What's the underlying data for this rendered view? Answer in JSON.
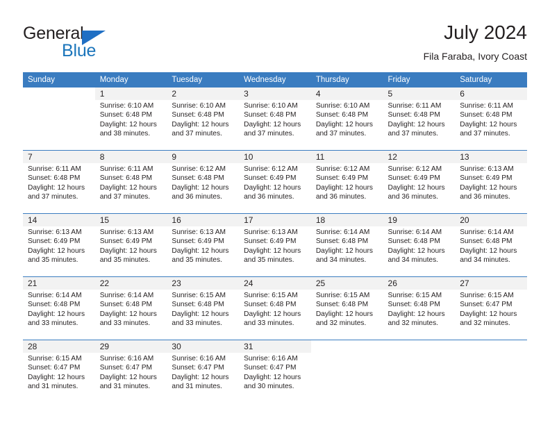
{
  "logo": {
    "word1": "General",
    "word2": "Blue",
    "triangle_color": "#1f6fc4",
    "blue_color": "#1b75bb"
  },
  "header": {
    "title": "July 2024",
    "subtitle": "Fila Faraba, Ivory Coast"
  },
  "theme": {
    "header_blue": "#3a7cc0",
    "band_gray": "#f2f2f2"
  },
  "weekday_headers": [
    "Sunday",
    "Monday",
    "Tuesday",
    "Wednesday",
    "Thursday",
    "Friday",
    "Saturday"
  ],
  "weeks": [
    [
      {
        "day": "",
        "lines": [
          "",
          "",
          "",
          ""
        ],
        "blank": true
      },
      {
        "day": "1",
        "lines": [
          "Sunrise: 6:10 AM",
          "Sunset: 6:48 PM",
          "Daylight: 12 hours",
          "and 38 minutes."
        ]
      },
      {
        "day": "2",
        "lines": [
          "Sunrise: 6:10 AM",
          "Sunset: 6:48 PM",
          "Daylight: 12 hours",
          "and 37 minutes."
        ]
      },
      {
        "day": "3",
        "lines": [
          "Sunrise: 6:10 AM",
          "Sunset: 6:48 PM",
          "Daylight: 12 hours",
          "and 37 minutes."
        ]
      },
      {
        "day": "4",
        "lines": [
          "Sunrise: 6:10 AM",
          "Sunset: 6:48 PM",
          "Daylight: 12 hours",
          "and 37 minutes."
        ]
      },
      {
        "day": "5",
        "lines": [
          "Sunrise: 6:11 AM",
          "Sunset: 6:48 PM",
          "Daylight: 12 hours",
          "and 37 minutes."
        ]
      },
      {
        "day": "6",
        "lines": [
          "Sunrise: 6:11 AM",
          "Sunset: 6:48 PM",
          "Daylight: 12 hours",
          "and 37 minutes."
        ]
      }
    ],
    [
      {
        "day": "7",
        "lines": [
          "Sunrise: 6:11 AM",
          "Sunset: 6:48 PM",
          "Daylight: 12 hours",
          "and 37 minutes."
        ]
      },
      {
        "day": "8",
        "lines": [
          "Sunrise: 6:11 AM",
          "Sunset: 6:48 PM",
          "Daylight: 12 hours",
          "and 37 minutes."
        ]
      },
      {
        "day": "9",
        "lines": [
          "Sunrise: 6:12 AM",
          "Sunset: 6:48 PM",
          "Daylight: 12 hours",
          "and 36 minutes."
        ]
      },
      {
        "day": "10",
        "lines": [
          "Sunrise: 6:12 AM",
          "Sunset: 6:49 PM",
          "Daylight: 12 hours",
          "and 36 minutes."
        ]
      },
      {
        "day": "11",
        "lines": [
          "Sunrise: 6:12 AM",
          "Sunset: 6:49 PM",
          "Daylight: 12 hours",
          "and 36 minutes."
        ]
      },
      {
        "day": "12",
        "lines": [
          "Sunrise: 6:12 AM",
          "Sunset: 6:49 PM",
          "Daylight: 12 hours",
          "and 36 minutes."
        ]
      },
      {
        "day": "13",
        "lines": [
          "Sunrise: 6:13 AM",
          "Sunset: 6:49 PM",
          "Daylight: 12 hours",
          "and 36 minutes."
        ]
      }
    ],
    [
      {
        "day": "14",
        "lines": [
          "Sunrise: 6:13 AM",
          "Sunset: 6:49 PM",
          "Daylight: 12 hours",
          "and 35 minutes."
        ]
      },
      {
        "day": "15",
        "lines": [
          "Sunrise: 6:13 AM",
          "Sunset: 6:49 PM",
          "Daylight: 12 hours",
          "and 35 minutes."
        ]
      },
      {
        "day": "16",
        "lines": [
          "Sunrise: 6:13 AM",
          "Sunset: 6:49 PM",
          "Daylight: 12 hours",
          "and 35 minutes."
        ]
      },
      {
        "day": "17",
        "lines": [
          "Sunrise: 6:13 AM",
          "Sunset: 6:49 PM",
          "Daylight: 12 hours",
          "and 35 minutes."
        ]
      },
      {
        "day": "18",
        "lines": [
          "Sunrise: 6:14 AM",
          "Sunset: 6:48 PM",
          "Daylight: 12 hours",
          "and 34 minutes."
        ]
      },
      {
        "day": "19",
        "lines": [
          "Sunrise: 6:14 AM",
          "Sunset: 6:48 PM",
          "Daylight: 12 hours",
          "and 34 minutes."
        ]
      },
      {
        "day": "20",
        "lines": [
          "Sunrise: 6:14 AM",
          "Sunset: 6:48 PM",
          "Daylight: 12 hours",
          "and 34 minutes."
        ]
      }
    ],
    [
      {
        "day": "21",
        "lines": [
          "Sunrise: 6:14 AM",
          "Sunset: 6:48 PM",
          "Daylight: 12 hours",
          "and 33 minutes."
        ]
      },
      {
        "day": "22",
        "lines": [
          "Sunrise: 6:14 AM",
          "Sunset: 6:48 PM",
          "Daylight: 12 hours",
          "and 33 minutes."
        ]
      },
      {
        "day": "23",
        "lines": [
          "Sunrise: 6:15 AM",
          "Sunset: 6:48 PM",
          "Daylight: 12 hours",
          "and 33 minutes."
        ]
      },
      {
        "day": "24",
        "lines": [
          "Sunrise: 6:15 AM",
          "Sunset: 6:48 PM",
          "Daylight: 12 hours",
          "and 33 minutes."
        ]
      },
      {
        "day": "25",
        "lines": [
          "Sunrise: 6:15 AM",
          "Sunset: 6:48 PM",
          "Daylight: 12 hours",
          "and 32 minutes."
        ]
      },
      {
        "day": "26",
        "lines": [
          "Sunrise: 6:15 AM",
          "Sunset: 6:48 PM",
          "Daylight: 12 hours",
          "and 32 minutes."
        ]
      },
      {
        "day": "27",
        "lines": [
          "Sunrise: 6:15 AM",
          "Sunset: 6:47 PM",
          "Daylight: 12 hours",
          "and 32 minutes."
        ]
      }
    ],
    [
      {
        "day": "28",
        "lines": [
          "Sunrise: 6:15 AM",
          "Sunset: 6:47 PM",
          "Daylight: 12 hours",
          "and 31 minutes."
        ]
      },
      {
        "day": "29",
        "lines": [
          "Sunrise: 6:16 AM",
          "Sunset: 6:47 PM",
          "Daylight: 12 hours",
          "and 31 minutes."
        ]
      },
      {
        "day": "30",
        "lines": [
          "Sunrise: 6:16 AM",
          "Sunset: 6:47 PM",
          "Daylight: 12 hours",
          "and 31 minutes."
        ]
      },
      {
        "day": "31",
        "lines": [
          "Sunrise: 6:16 AM",
          "Sunset: 6:47 PM",
          "Daylight: 12 hours",
          "and 30 minutes."
        ]
      },
      {
        "day": "",
        "lines": [
          "",
          "",
          "",
          ""
        ],
        "blank": true
      },
      {
        "day": "",
        "lines": [
          "",
          "",
          "",
          ""
        ],
        "blank": true
      },
      {
        "day": "",
        "lines": [
          "",
          "",
          "",
          ""
        ],
        "blank": true
      }
    ]
  ]
}
